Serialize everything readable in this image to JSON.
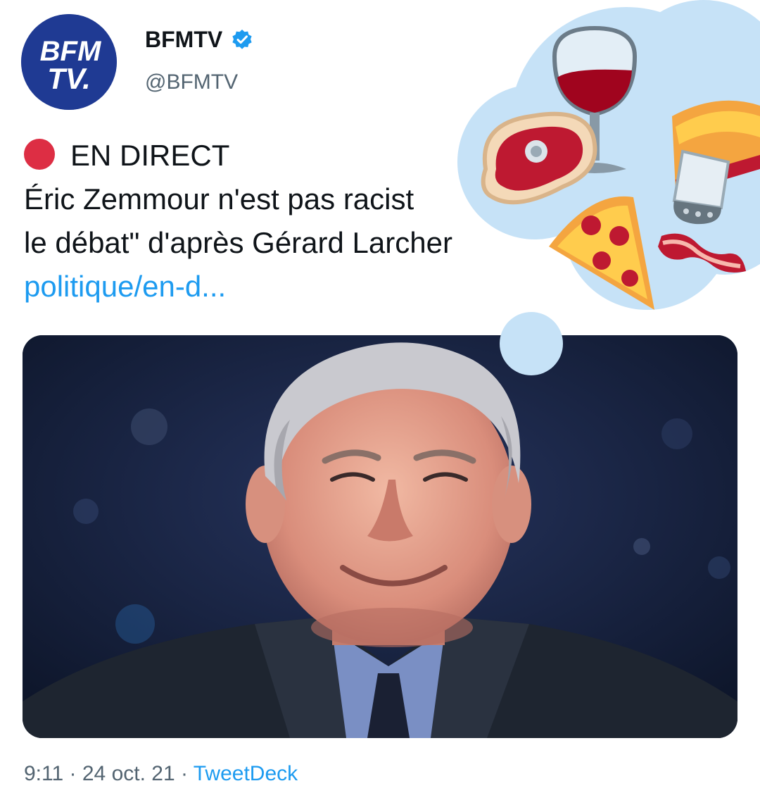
{
  "account": {
    "avatar_text_line1": "BFM",
    "avatar_text_line2": "TV.",
    "display_name": "BFMTV",
    "handle": "@BFMTV",
    "verified": true,
    "brand_color": "#1f3a93"
  },
  "tweet": {
    "live_label": "EN DIRECT",
    "line2": "Éric Zemmour n'est pas racist",
    "line3": "le débat\" d'après Gérard Larcher",
    "link_text": "politique/en-d..."
  },
  "overlay": {
    "emojis": [
      "wine-glass",
      "meat-on-bone",
      "pie",
      "salt-shaker",
      "pizza",
      "bacon"
    ],
    "bubble_color": "#c6e2f7"
  },
  "footer": {
    "time": "9:11",
    "separator": "·",
    "date": "24 oct. 21",
    "source": "TweetDeck"
  },
  "colors": {
    "link": "#1d9bf0",
    "secondary_text": "#536471",
    "live_dot": "#dd2e44"
  }
}
